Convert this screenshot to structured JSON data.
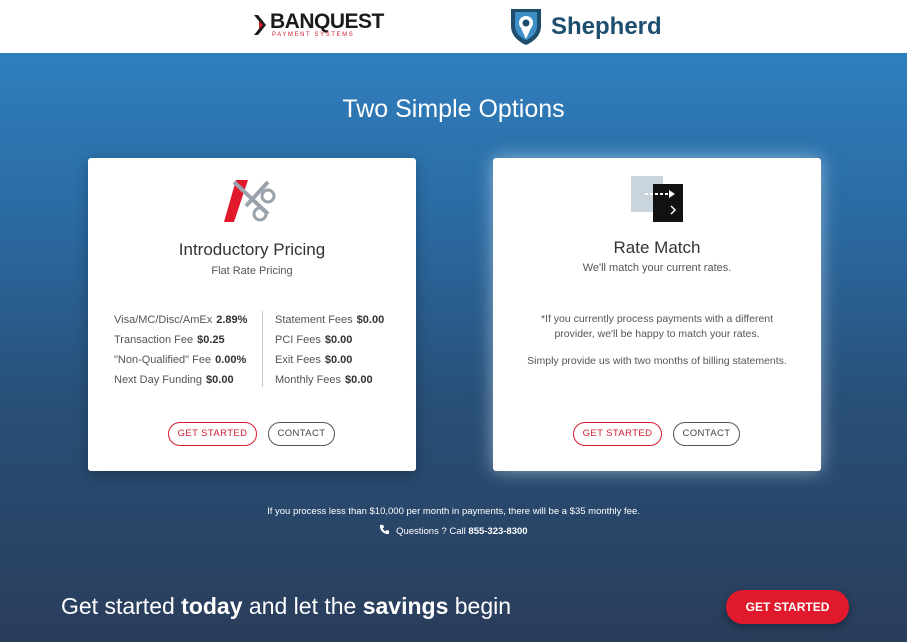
{
  "header": {
    "banquest": {
      "name": "BANQUEST",
      "tagline": "PAYMENT SYSTEMS",
      "mark_icon": "banquest-chevron-logo"
    },
    "shepherd": {
      "name": "Shepherd",
      "mark_icon": "shield-pin-logo"
    }
  },
  "section_title": "Two Simple Options",
  "cards": {
    "intro": {
      "icon": "scissors-icon",
      "title": "Introductory Pricing",
      "subtitle": "Flat Rate Pricing",
      "fees_left": [
        {
          "label": "Visa/MC/Disc/AmEx",
          "value": "2.89%"
        },
        {
          "label": "Transaction Fee",
          "value": "$0.25"
        },
        {
          "label": "\"Non-Qualified\" Fee",
          "value": "0.00%"
        },
        {
          "label": "Next Day Funding",
          "value": "$0.00"
        }
      ],
      "fees_right": [
        {
          "label": "Statement Fees",
          "value": "$0.00"
        },
        {
          "label": "PCI Fees",
          "value": "$0.00"
        },
        {
          "label": "Exit Fees",
          "value": "$0.00"
        },
        {
          "label": "Monthly Fees",
          "value": "$0.00"
        }
      ],
      "get_started": "GET STARTED",
      "contact": "CONTACT"
    },
    "match": {
      "icon": "rate-match-arrow-icon",
      "title": "Rate Match",
      "subtitle": "We'll match your current rates.",
      "note1": "*If you currently process payments with a different provider, we'll be happy to match your rates.",
      "note2": "Simply provide us with two months of billing statements.",
      "get_started": "GET STARTED",
      "contact": "CONTACT"
    }
  },
  "fine_print": "If you process less than $10,000 per month in payments, there will be a $35 monthly fee.",
  "questions": {
    "prefix": "Questions ? Call",
    "phone": "855-323-8300",
    "icon": "phone-icon"
  },
  "cta": {
    "part1": "Get started ",
    "bold1": "today",
    "part2": " and let the ",
    "bold2": "savings",
    "part3": " begin",
    "button": "GET STARTED"
  },
  "colors": {
    "accent_red": "#e0192c",
    "shepherd_blue": "#1d4e6e",
    "hero_top": "#2f7fbd",
    "hero_bottom": "#2a3d5a"
  }
}
